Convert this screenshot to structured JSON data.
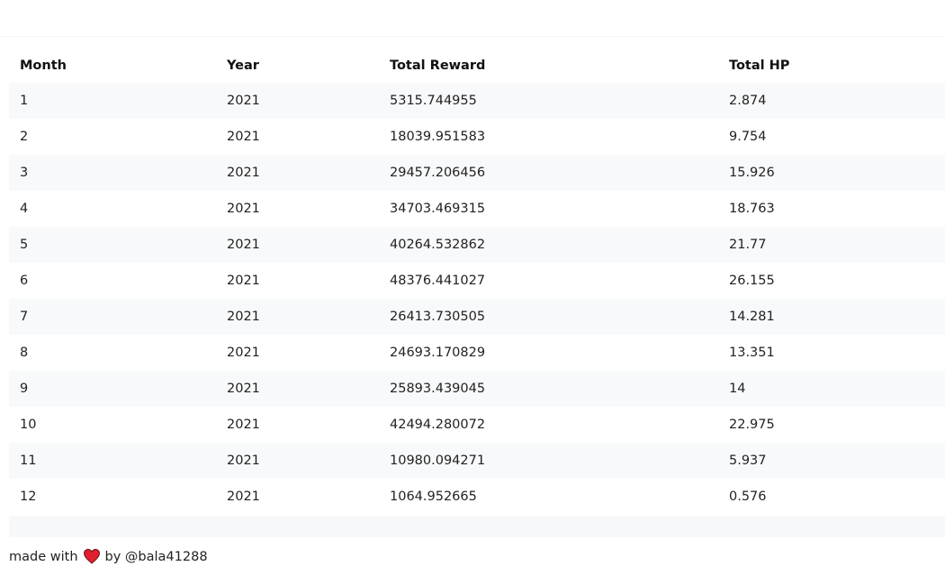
{
  "table": {
    "columns": [
      "Month",
      "Year",
      "Total Reward",
      "Total HP"
    ],
    "rows": [
      [
        "1",
        "2021",
        "5315.744955",
        "2.874"
      ],
      [
        "2",
        "2021",
        "18039.951583",
        "9.754"
      ],
      [
        "3",
        "2021",
        "29457.206456",
        "15.926"
      ],
      [
        "4",
        "2021",
        "34703.469315",
        "18.763"
      ],
      [
        "5",
        "2021",
        "40264.532862",
        "21.77"
      ],
      [
        "6",
        "2021",
        "48376.441027",
        "26.155"
      ],
      [
        "7",
        "2021",
        "26413.730505",
        "14.281"
      ],
      [
        "8",
        "2021",
        "24693.170829",
        "13.351"
      ],
      [
        "9",
        "2021",
        "25893.439045",
        "14"
      ],
      [
        "10",
        "2021",
        "42494.280072",
        "22.975"
      ],
      [
        "11",
        "2021",
        "10980.094271",
        "5.937"
      ],
      [
        "12",
        "2021",
        "1064.952665",
        "0.576"
      ]
    ]
  },
  "footer": {
    "prefix": "made with",
    "icon": "heart-icon",
    "heart_color": "#e0202e",
    "suffix": "by @bala41288"
  }
}
